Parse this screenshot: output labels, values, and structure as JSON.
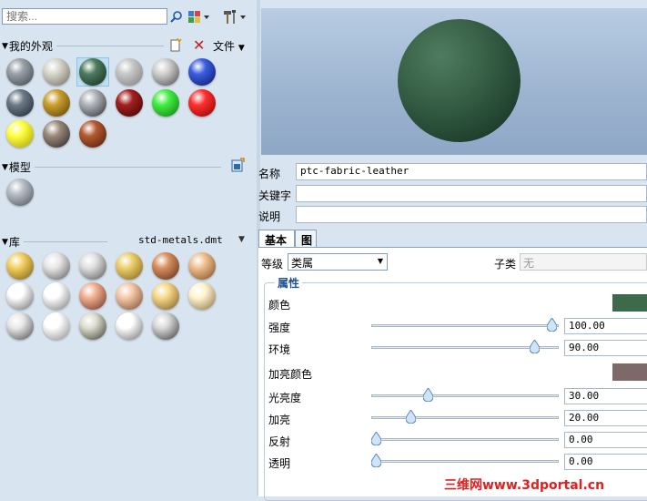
{
  "search": {
    "placeholder": "搜索..."
  },
  "sections": {
    "my_appearances": {
      "title": "我的外观",
      "file_menu_label": "文件"
    },
    "model": {
      "title": "模型"
    },
    "library": {
      "title": "库",
      "file_name": "std-metals.dmt"
    }
  },
  "my_swatches": [
    {
      "name": "silver-gray",
      "color": "#9aa0a8",
      "dark": "#3c4148"
    },
    {
      "name": "pearl",
      "color": "#d8d6cc",
      "dark": "#6e6a5e"
    },
    {
      "name": "green",
      "color": "#4f7c60",
      "dark": "#12281c"
    },
    {
      "name": "light-gray",
      "color": "#c8c8c8",
      "dark": "#7c7c7c"
    },
    {
      "name": "chrome",
      "color": "#d0d0d0",
      "dark": "#4a4a4a"
    },
    {
      "name": "blue",
      "color": "#3a5fe0",
      "dark": "#0a1466"
    },
    {
      "name": "dark-slate",
      "color": "#6d7a88",
      "dark": "#1c2530"
    },
    {
      "name": "bronze",
      "color": "#c9a030",
      "dark": "#5a3c00"
    },
    {
      "name": "dark-metal",
      "color": "#b0b4b8",
      "dark": "#2a2d30"
    },
    {
      "name": "dark-red",
      "color": "#a32020",
      "dark": "#3a0000"
    },
    {
      "name": "bright-green",
      "color": "#44ee44",
      "dark": "#0a7a0a"
    },
    {
      "name": "red",
      "color": "#ff3030",
      "dark": "#8a0000"
    },
    {
      "name": "yellow",
      "color": "#ffff40",
      "dark": "#a8a000"
    },
    {
      "name": "granite",
      "color": "#9a8a7a",
      "dark": "#2a2228"
    },
    {
      "name": "rust",
      "color": "#b45a30",
      "dark": "#4a1808"
    }
  ],
  "model_swatches": [
    {
      "name": "model-silver",
      "color": "#b8bec6",
      "dark": "#4a5058"
    }
  ],
  "lib_swatches": [
    {
      "name": "gold",
      "color": "#f2d060",
      "dark": "#7a5a10"
    },
    {
      "name": "silver",
      "color": "#e8e8e8",
      "dark": "#5a5a5a"
    },
    {
      "name": "steel",
      "color": "#e0e0e0",
      "dark": "#555555"
    },
    {
      "name": "brass",
      "color": "#ecd070",
      "dark": "#806010"
    },
    {
      "name": "copper",
      "color": "#d89060",
      "dark": "#5a2a10"
    },
    {
      "name": "bronze-light",
      "color": "#f0c090",
      "dark": "#7a4a20"
    },
    {
      "name": "aluminum",
      "color": "#ffffff",
      "dark": "#6a6a6a"
    },
    {
      "name": "white-metal",
      "color": "#ffffff",
      "dark": "#7a7a7a"
    },
    {
      "name": "rose-copper",
      "color": "#f0b090",
      "dark": "#6a3020"
    },
    {
      "name": "pale-copper",
      "color": "#f4c8a8",
      "dark": "#7a4a30"
    },
    {
      "name": "antique-gold",
      "color": "#f8d88a",
      "dark": "#7a5a20"
    },
    {
      "name": "champagne",
      "color": "#fff4d0",
      "dark": "#8a7040"
    },
    {
      "name": "pewter",
      "color": "#e8e8e8",
      "dark": "#4a4a4a"
    },
    {
      "name": "platinum",
      "color": "#ffffff",
      "dark": "#8a8a8a"
    },
    {
      "name": "gunmetal",
      "color": "#dcdcd0",
      "dark": "#3a3a30"
    },
    {
      "name": "polished",
      "color": "#ffffff",
      "dark": "#707070"
    },
    {
      "name": "dark-chrome",
      "color": "#d8d8d8",
      "dark": "#3a3a3a"
    }
  ],
  "fields": {
    "name_label": "名称",
    "name_value": "ptc-fabric-leather",
    "keyword_label": "关键字",
    "keyword_value": "",
    "desc_label": "说明",
    "desc_value": ""
  },
  "tabs": {
    "basic": "基本",
    "map": "图"
  },
  "class": {
    "label": "等级",
    "value": "类属",
    "subclass_label": "子类",
    "subclass_value": "无"
  },
  "properties": {
    "legend": "属性",
    "color_label": "颜色",
    "color_value": "#3e6a4c",
    "intensity_label": "强度",
    "intensity_value": "100.00",
    "ambient_label": "环境",
    "ambient_value": "90.00",
    "highlight_color_label": "加亮颜色",
    "highlight_color_value": "#7e6868",
    "shininess_label": "光亮度",
    "shininess_value": "30.00",
    "highlight_label": "加亮",
    "highlight_value": "20.00",
    "reflection_label": "反射",
    "reflection_value": "0.00",
    "transparency_label": "透明",
    "transparency_value": "0.00"
  },
  "watermark": "三维网www.3dportal.cn"
}
